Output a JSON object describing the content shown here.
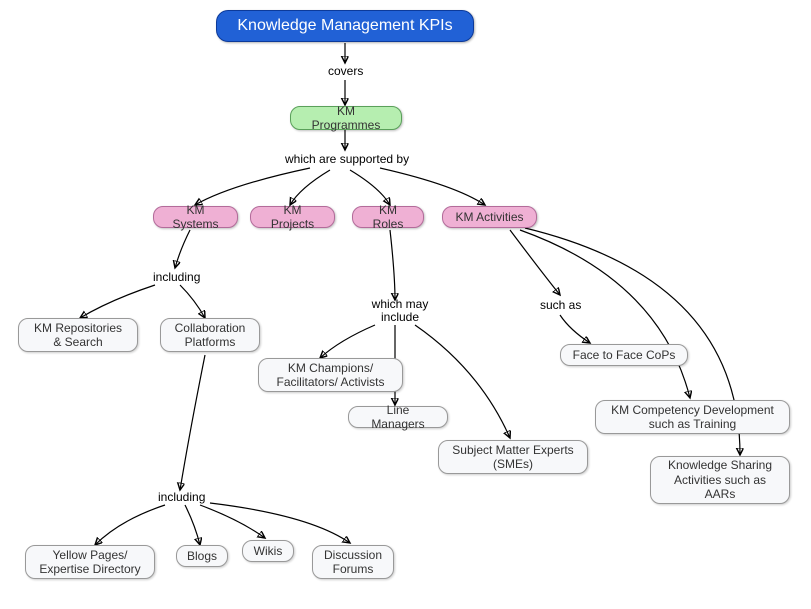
{
  "title": "Knowledge Management KPIs",
  "edges": {
    "covers": "covers",
    "supported": "which are supported by",
    "including1": "including",
    "mayinclude": "which may include",
    "suchas": "such as",
    "including2": "including"
  },
  "nodes": {
    "programmes": "KM Programmes",
    "systems": "KM Systems",
    "projects": "KM Projects",
    "roles": "KM Roles",
    "activities": "KM Activities",
    "repo": "KM Repositories & Search",
    "collab": "Collaboration Platforms",
    "champions": "KM Champions/ Facilitators/ Activists",
    "linemgr": "Line Managers",
    "smes": "Subject Matter Experts (SMEs)",
    "cops": "Face to Face CoPs",
    "training": "KM Competency Development such as Training",
    "sharing": "Knowledge Sharing Activities such as AARs",
    "yellow": "Yellow Pages/ Expertise Directory",
    "blogs": "Blogs",
    "wikis": "Wikis",
    "forums": "Discussion Forums"
  }
}
